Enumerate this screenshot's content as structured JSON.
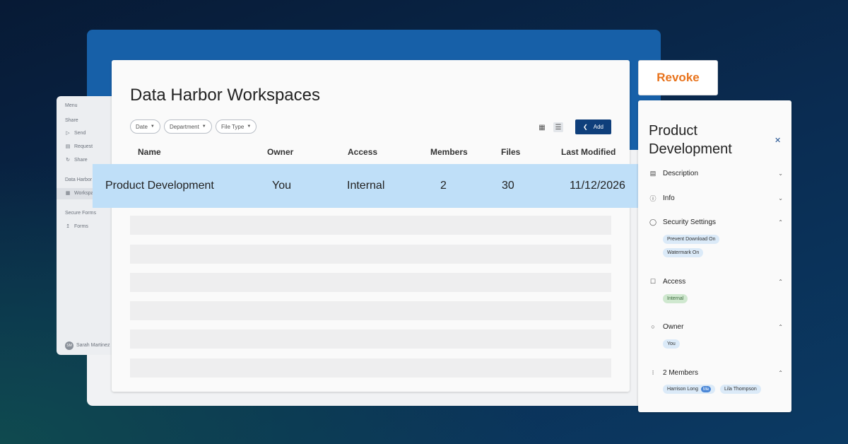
{
  "sidebar": {
    "menu_label": "Menu",
    "share_section": "Share",
    "share_items": [
      {
        "label": "Send",
        "icon": "send-icon"
      },
      {
        "label": "Request",
        "icon": "request-icon"
      },
      {
        "label": "Share",
        "icon": "share-icon"
      }
    ],
    "data_harbor_section": "Data Harbor",
    "workspaces_label": "Workspaces",
    "secure_forms_section": "Secure Forms",
    "forms_label": "Forms",
    "user_initials": "SM",
    "user_name": "Sarah Martinez"
  },
  "main": {
    "title": "Data Harbor Workspaces",
    "filters": [
      {
        "label": "Date"
      },
      {
        "label": "Department"
      },
      {
        "label": "File Type"
      }
    ],
    "add_label": "Add",
    "columns": [
      "Name",
      "Owner",
      "Access",
      "Members",
      "Files",
      "Last Modified"
    ],
    "selected_row": {
      "name": "Product Development",
      "owner": "You",
      "access": "Internal",
      "members": "2",
      "files": "30",
      "last_modified": "11/12/2026"
    }
  },
  "revoke_label": "Revoke",
  "details": {
    "title": "Product Development",
    "sections": {
      "description": "Description",
      "info": "Info",
      "security": "Security Settings",
      "access": "Access",
      "owner": "Owner",
      "members": "2 Members"
    },
    "security_tags": [
      "Prevent Download On",
      "Watermark On"
    ],
    "access_tag": "Internal",
    "owner_tag": "You",
    "member_tags": [
      "Harrison Long",
      "Lila Thompson"
    ],
    "me_badge": "Me"
  },
  "colors": {
    "accent": "#0f3f7b",
    "highlight_row": "#bfdff8",
    "revoke": "#e8731c",
    "backdrop_blue": "#1760a8"
  }
}
